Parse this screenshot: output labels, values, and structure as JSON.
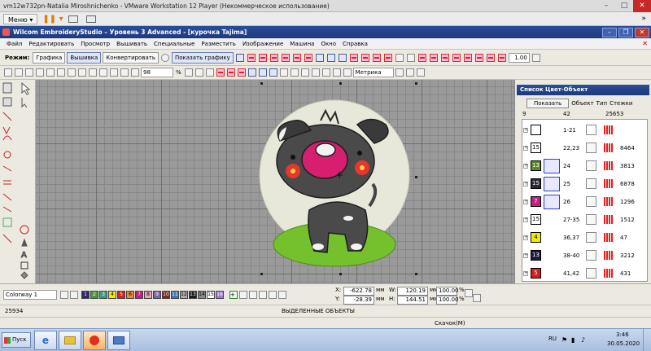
{
  "vm": {
    "title": "vm12w732pn-Natalia Miroshnichenko - VMware Workstation 12 Player (Некоммерческое использование)",
    "menu_label": "Меню"
  },
  "app": {
    "title": "Wilcom EmbroideryStudio – Уровень 3 Advanced - [курочка      Tajima]"
  },
  "menu": [
    "Файл",
    "Редактировать",
    "Просмотр",
    "Вышивать",
    "Специальные",
    "Разместить",
    "Изображение",
    "Машина",
    "Окно",
    "Справка"
  ],
  "mode_toolbar": {
    "label": "Режим:",
    "buttons": [
      "Графика",
      "Вышивка",
      "Конвертировать",
      "Показать графику"
    ],
    "zoom_value": "1.00"
  },
  "toolbar2": {
    "zoom": "98",
    "zoom_unit": "%",
    "units": "Метрика"
  },
  "panel": {
    "title": "Список Цвет-Объект",
    "show_button": "Показать",
    "headers": [
      "Объект",
      "Тип",
      "Стежки"
    ],
    "summary": {
      "a": "9",
      "b": "42",
      "c": "25653"
    },
    "rows": [
      {
        "box": "",
        "box_color": "#ffffff",
        "range": "1-21",
        "stitches": "",
        "selected": false
      },
      {
        "box": "15",
        "box_color": "#ffffff",
        "range": "22,23",
        "stitches": "8464",
        "selected": false
      },
      {
        "box": "13",
        "box_color": "#5a8a24",
        "range": "24",
        "stitches": "3813",
        "selected": true
      },
      {
        "box": "15",
        "box_color": "#2a2a3a",
        "range": "25",
        "stitches": "6878",
        "selected": true
      },
      {
        "box": "7",
        "box_color": "#c01f7f",
        "range": "26",
        "stitches": "1296",
        "selected": true
      },
      {
        "box": "15",
        "box_color": "#ffffff",
        "range": "27-35",
        "stitches": "1512",
        "selected": false
      },
      {
        "box": "4",
        "box_color": "#f3e800",
        "range": "36,37",
        "stitches": "47",
        "selected": false
      },
      {
        "box": "13",
        "box_color": "#1c1c40",
        "range": "38-40",
        "stitches": "3212",
        "selected": false
      },
      {
        "box": "5",
        "box_color": "#d91e1e",
        "range": "41,42",
        "stitches": "431",
        "selected": false
      }
    ]
  },
  "colorway": {
    "name": "Colorway 1",
    "swatches": [
      {
        "n": "1",
        "c": "#2d2a6e",
        "t": "#fff"
      },
      {
        "n": "2",
        "c": "#4a9a3a",
        "t": "#fff"
      },
      {
        "n": "3",
        "c": "#3f9a87",
        "t": "#fff"
      },
      {
        "n": "4",
        "c": "#f3e800",
        "t": "#000"
      },
      {
        "n": "5",
        "c": "#d91e1e",
        "t": "#fff"
      },
      {
        "n": "6",
        "c": "#e48a3a",
        "t": "#000"
      },
      {
        "n": "7",
        "c": "#c01f7f",
        "t": "#fff"
      },
      {
        "n": "8",
        "c": "#e8a6b7",
        "t": "#000"
      },
      {
        "n": "9",
        "c": "#7a63b0",
        "t": "#fff"
      },
      {
        "n": "10",
        "c": "#7d2a1f",
        "t": "#fff"
      },
      {
        "n": "11",
        "c": "#3a7ab8",
        "t": "#fff"
      },
      {
        "n": "12",
        "c": "#aaaaaa",
        "t": "#000"
      },
      {
        "n": "13",
        "c": "#1c1c1c",
        "t": "#fff"
      },
      {
        "n": "14",
        "c": "#8a8a8a",
        "t": "#000"
      },
      {
        "n": "15",
        "c": "#ffffff",
        "t": "#000"
      },
      {
        "n": "16",
        "c": "#a07ad6",
        "t": "#fff"
      }
    ]
  },
  "coords": {
    "x_label": "X:",
    "x": "-622.78",
    "x_unit": "мм",
    "y_label": "Y:",
    "y": "-28.39",
    "y_unit": "мм",
    "w_label": "W:",
    "w": "120.19",
    "w_unit": "мм",
    "h_label": "H:",
    "h": "144.51",
    "h_unit": "мм",
    "sx": "100.00",
    "sy": "100.00",
    "pct": "%"
  },
  "status": {
    "stitches": "25934",
    "selected": "ВЫДЕЛЕННЫЕ ОБЪЕКТЫ",
    "hint": "Скачок(М)"
  },
  "taskbar": {
    "start": "Пуск",
    "lang": "RU",
    "time": "3:46",
    "date": "30.05.2020"
  }
}
